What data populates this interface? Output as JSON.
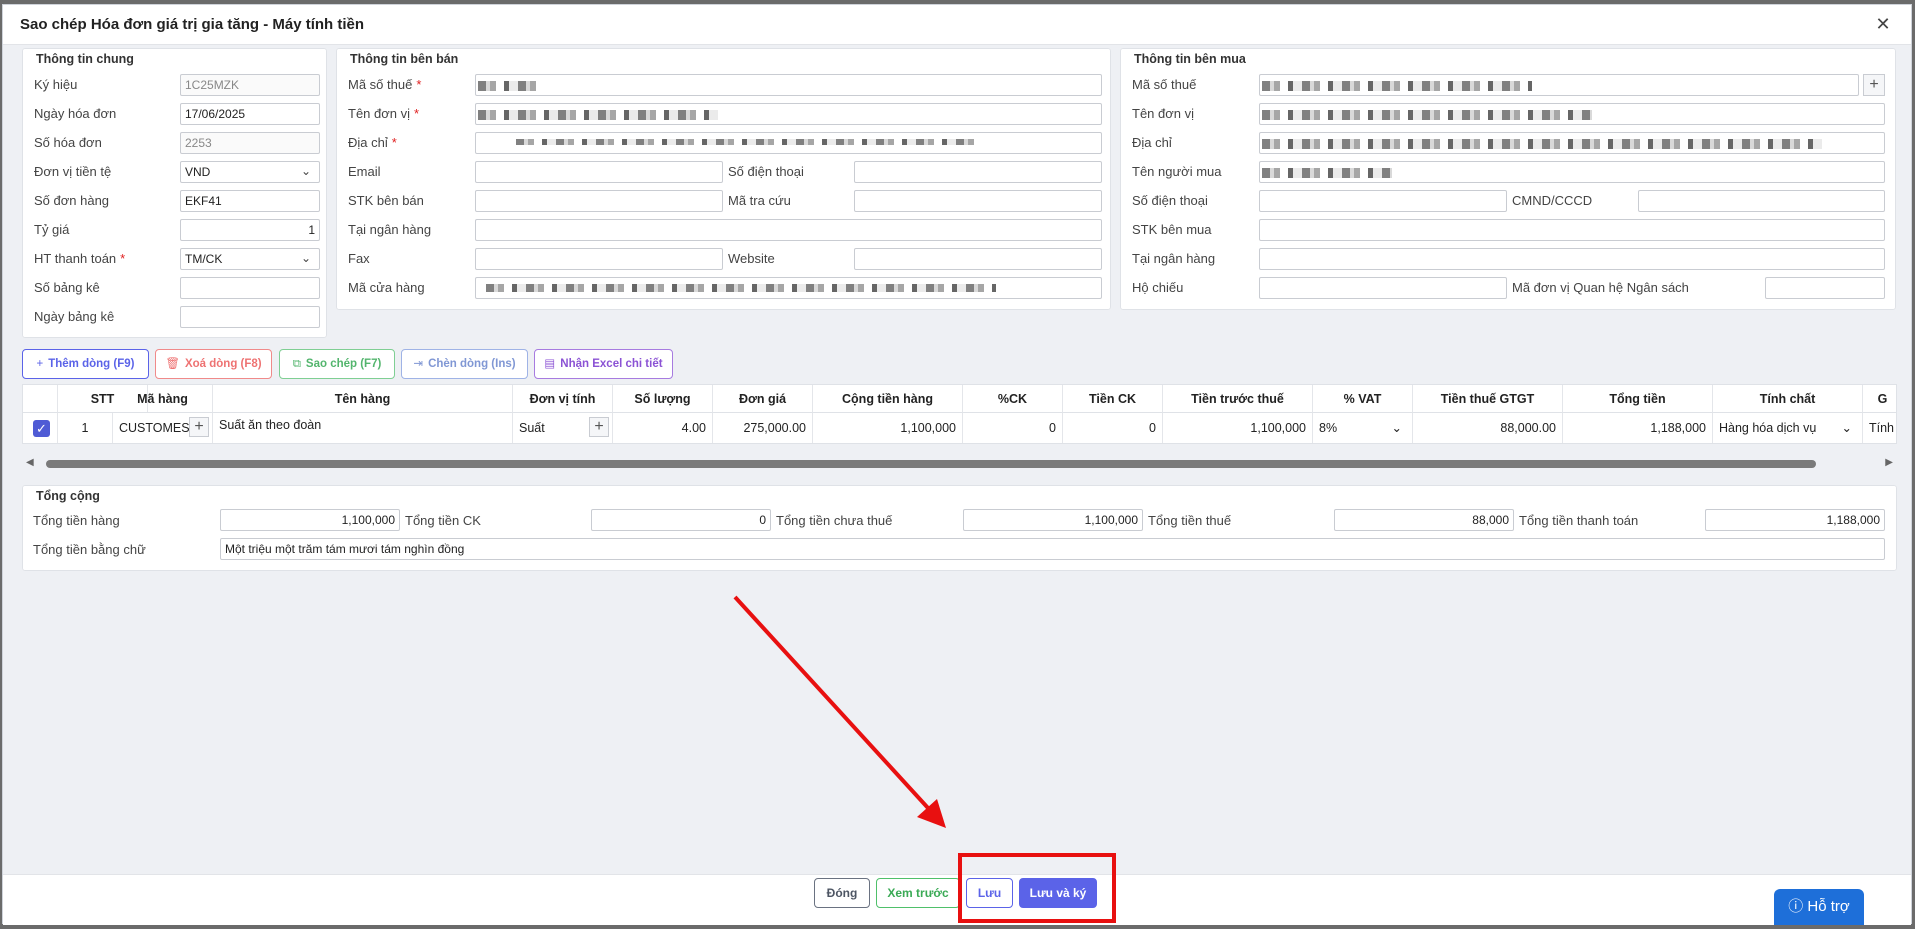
{
  "title": "Sao chép Hóa đơn giá trị gia tăng - Máy tính tiền",
  "close_glyph": "✕",
  "general": {
    "legend": "Thông tin chung",
    "fields": [
      {
        "label": "Ký hiệu",
        "value": "1C25MZK"
      },
      {
        "label": "Ngày hóa đơn",
        "value": "17/06/2025"
      },
      {
        "label": "Số hóa đơn",
        "value": "2253"
      },
      {
        "label": "Đơn vị tiền tệ",
        "value": "VND"
      },
      {
        "label": "Số đơn hàng",
        "value": "EKF41"
      },
      {
        "label": "Tỷ giá",
        "value": "1"
      },
      {
        "label": "HT thanh toán",
        "value": "TM/CK"
      },
      {
        "label": "Số bảng kê",
        "value": ""
      },
      {
        "label": "Ngày bảng kê",
        "value": ""
      }
    ]
  },
  "seller": {
    "legend": "Thông tin bên bán",
    "tax_code": "Mã số thuế",
    "unit_name": "Tên đơn vị",
    "address": "Địa chỉ",
    "email": "Email",
    "phone": "Số điện thoại",
    "account": "STK bên bán",
    "lookup": "Mã tra cứu",
    "bank": "Tại ngân hàng",
    "fax": "Fax",
    "website": "Website",
    "store": "Mã cửa hàng"
  },
  "buyer": {
    "legend": "Thông tin bên mua",
    "tax_code": "Mã số thuế",
    "unit_name": "Tên đơn vị",
    "address": "Địa chỉ",
    "buyer_name": "Tên người mua",
    "phone": "Số điện thoại",
    "id_card": "CMND/CCCD",
    "account": "STK bên mua",
    "bank": "Tại ngân hàng",
    "passport": "Hộ chiếu",
    "budget": "Mã đơn vị Quan hệ Ngân sách"
  },
  "toolbar": {
    "add": "Thêm dòng (F9)",
    "delete": "Xoá dòng (F8)",
    "copy": "Sao chép (F7)",
    "insert": "Chèn dòng (Ins)",
    "excel": "Nhận Excel chi tiết"
  },
  "table": {
    "headers": [
      "STT",
      "Mã hàng",
      "Tên hàng",
      "Đơn vị tính",
      "Số lượng",
      "Đơn giá",
      "Cộng tiền hàng",
      "%CK",
      "Tiền CK",
      "Tiền trước thuế",
      "% VAT",
      "Tiền thuế GTGT",
      "Tổng tiền",
      "Tính chất",
      "G"
    ],
    "row": {
      "stt": "1",
      "code": "CUSTOMES",
      "name": "Suất ăn theo đoàn",
      "unit": "Suất",
      "qty": "4.00",
      "price": "275,000.00",
      "amount": "1,100,000",
      "ck_pct": "0",
      "ck": "0",
      "pretax": "1,100,000",
      "vat": "8%",
      "vat_amount": "88,000.00",
      "total": "1,188,000",
      "nature": "Hàng hóa dịch vụ",
      "extra": "Tính"
    }
  },
  "totals": {
    "legend": "Tổng cộng",
    "goods_label": "Tổng tiền hàng",
    "goods": "1,100,000",
    "ck_label": "Tổng tiền CK",
    "ck": "0",
    "pretax_label": "Tổng tiền chưa thuế",
    "pretax": "1,100,000",
    "tax_label": "Tổng tiền thuế",
    "tax": "88,000",
    "pay_label": "Tổng tiền thanh toán",
    "pay": "1,188,000",
    "words_label": "Tổng tiền bằng chữ",
    "words": "Một triệu một trăm tám mươi tám nghìn đồng"
  },
  "footer": {
    "close": "Đóng",
    "preview": "Xem trước",
    "save": "Lưu",
    "save_sign": "Lưu và ký"
  },
  "help": "Hỗ trợ",
  "colors": {
    "accent": "#5b63e8",
    "annotation": "#e81010",
    "help": "#1e6fd9"
  }
}
